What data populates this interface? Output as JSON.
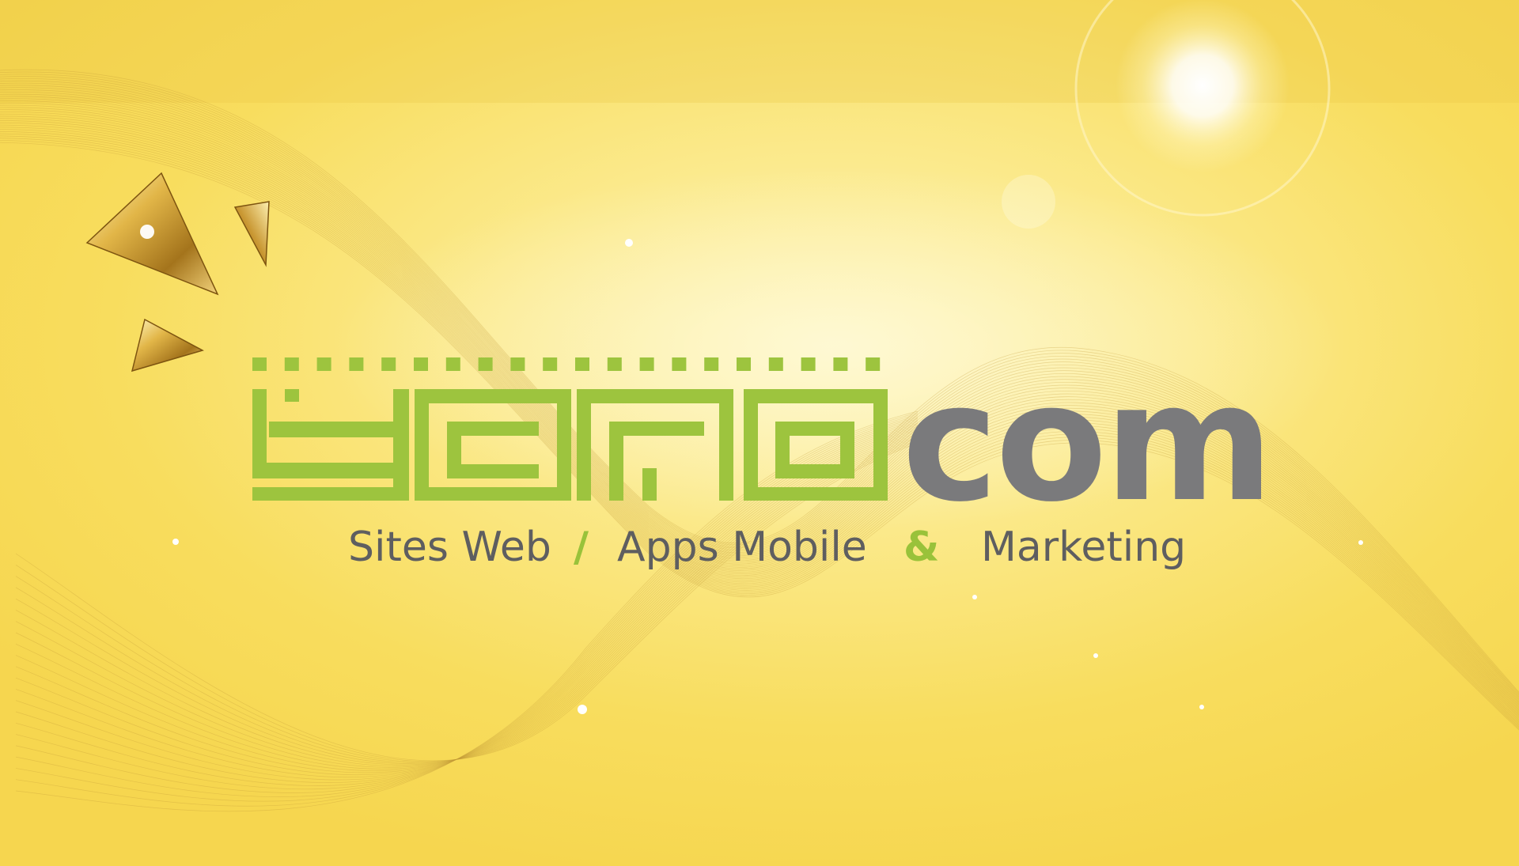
{
  "logo": {
    "mark": "yana",
    "wordmark": "com",
    "mark_color": "#9dc43e",
    "wordmark_color": "#7a7a7c"
  },
  "tagline": {
    "part1": "Sites Web",
    "sep1": "/",
    "part2": "Apps Mobile",
    "sep2": "&",
    "part3": "Marketing",
    "text_color": "#5e5e60",
    "separator_color": "#99c23a"
  },
  "background": {
    "color": "#f8dd5e",
    "sun_glow": "#ffffff"
  },
  "decorations": [
    "gold-triangle-icon",
    "gold-triangle-icon",
    "gold-triangle-icon"
  ]
}
